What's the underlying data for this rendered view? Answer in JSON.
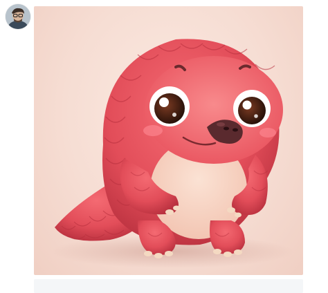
{
  "user": {
    "avatar_icon": "user-avatar-photo"
  },
  "message": {
    "image": {
      "subject_icon": "red-pangolin-cartoon-illustration",
      "colors": {
        "background": "#f6ddd3",
        "body": "#e8505b",
        "belly": "#f7d4c3"
      }
    }
  }
}
